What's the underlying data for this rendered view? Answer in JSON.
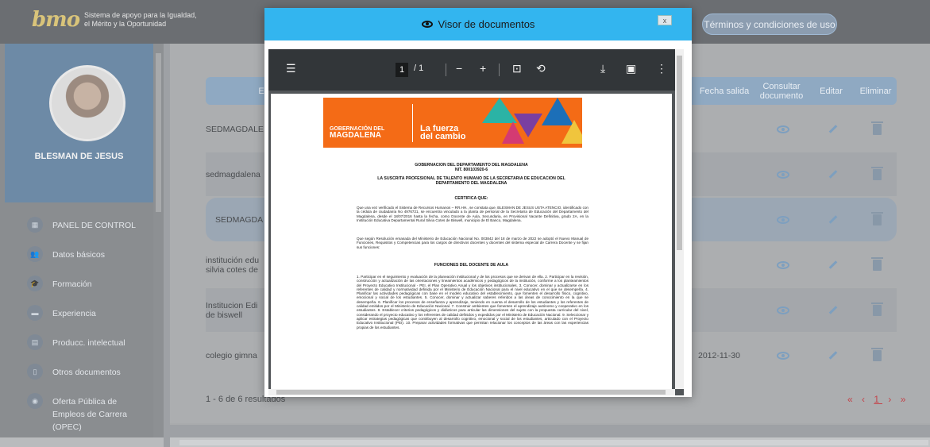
{
  "header": {
    "logo_mark": "bmo",
    "logo_line1": "Sistema de apoyo para la Igualdad,",
    "logo_line2": "el Mérito y la Oportunidad",
    "terms_label": "Términos y condiciones de uso"
  },
  "profile": {
    "name": "BLESMAN DE JESUS"
  },
  "sidebar": {
    "items": [
      {
        "label": "PANEL DE CONTROL",
        "icon": "dashboard-icon"
      },
      {
        "label": "Datos básicos",
        "icon": "people-icon"
      },
      {
        "label": "Formación",
        "icon": "graduate-icon"
      },
      {
        "label": "Experiencia",
        "icon": "briefcase-icon"
      },
      {
        "label": "Producc. intelectual",
        "icon": "book-icon"
      },
      {
        "label": "Otros documentos",
        "icon": "document-icon"
      },
      {
        "label": "Oferta Pública de",
        "label2": "Empleos de Carrera (OPEC)",
        "icon": "globe-icon"
      }
    ]
  },
  "table": {
    "headers": {
      "entity": "E",
      "exit_date": "Fecha salida",
      "view_doc": "Consultar documento",
      "edit": "Editar",
      "delete": "Eliminar"
    },
    "rows": [
      {
        "entity": "SEDMAGDALE",
        "exit_date": ""
      },
      {
        "entity": "sedmagdalena",
        "exit_date": ""
      },
      {
        "entity": "SEDMAGDA",
        "exit_date": ""
      },
      {
        "entity": "institución edu\nsilvia cotes de",
        "exit_date": ""
      },
      {
        "entity": "Institucion Edi\nde biswell",
        "exit_date": ""
      },
      {
        "entity": "colegio gimna",
        "exit_date": "2012-11-30"
      }
    ],
    "footer_count": "1 - 6 de 6 resultados",
    "pager": {
      "first": "«",
      "prev": "‹",
      "current": "1",
      "next": "›",
      "last": "»"
    }
  },
  "modal": {
    "title": "Visor de documentos",
    "close_label": "x",
    "pdf": {
      "page_current": "1",
      "page_total": "/ 1",
      "banner_gov_line1": "GOBERNACIÓN DEL",
      "banner_gov_line2": "MAGDALENA",
      "banner_slogan1": "La fuerza",
      "banner_slogan2": "del cambio",
      "heading1": "GOBERNACION DEL DEPARTAMENTO DEL MAGDALENA",
      "heading2": "NIT. 800103920-6",
      "heading3": "LA SUSCRITA PROFESIONAL DE TALENTO HUMANO DE LA SECRETARIA DE EDUCACION DEL",
      "heading4": "DEPARTAMENTO DEL MAGDALENA",
      "certifica": "CERTIFICA QUE:",
      "para1": "Que una vez verificado el Sistema de Recursos Humanos – RR.HH., se constata que, BLESMAN DE JESUS USTA ATENCIO, identificado con la cédula de ciudadanía No 4976721, se encuentra vinculado a la planta de personal de la Secretaría de Educación del Departamento del Magdalena, desde el 18/07/2016 hasta la fecha, como Docente de Aula, Secundaria, en Provisional Vacante Definitiva, grado 2A, en la Institución Educativa Departamental Rural Silvia Cotes de Biswell, municipio de El Banco, Magdalena.",
      "para2": "Que según Resolución emanada del Ministerio de Educación Nacional No. 003842 del 18 de marzo de 2022 se adoptó el Nuevo Manual de Funciones, Requisitos y Competencias para los cargos de directivos docentes y docentes del sistema especial de Carrera Docente y se fijan sus funciones:",
      "funciones": "FUNCIONES DEL DOCENTE DE AULA",
      "para3": "1. Participar en el seguimiento y evaluación de la planeación institucional y de los procesos que se derivan de ella. 2. Participar en la revisión, construcción y actualización de las orientaciones y lineamientos académicos y pedagógicos de la institución, conforme a los planteamientos del Proyecto Educativo Institucional - PEI, el Plan Operativo Anual y los objetivos institucionales. 3. Conocer, dominar y actualizarse en los referentes de calidad y normatividad definida por el Ministerio de Educación Nacional para el nivel educativo en el que se desempeña. 4. Planificar las actividades pedagógicas con base en el modelo educativo del establecimiento, que fomenten el desarrollo físico, cognitivo, emocional y social de los estudiantes. 5. Conocer, dominar y actualizar saberes referidos a las áreas de conocimiento en la que se desempeña. 6. Planificar los procesos de enseñanza y aprendizaje, teniendo en cuenta el desarrollo de los estudiantes y los referentes de calidad emitidos por el Ministerio de Educación Nacional. 7. Construir ambientes que fomenten el aprendizaje autónomo y cooperativo en los estudiantes. 8. Establecer criterios pedagógicos y didácticos para articular las dimensiones del sujeto con la propuesta curricular del nivel, considerando el proyecto educativo y los referentes de calidad definidos y expedidos por el Ministerio de Educación Nacional. 9. Seleccionar y aplicar estrategias pedagógicas que contribuyen al desarrollo cognitivo, emocional y social de los estudiantes, articulado con el Proyecto Educativo Institucional (PEI). 10. Preparar actividades formativas que permitan relacionar los conceptos de las áreas con las experiencias propias de los estudiantes."
    }
  }
}
